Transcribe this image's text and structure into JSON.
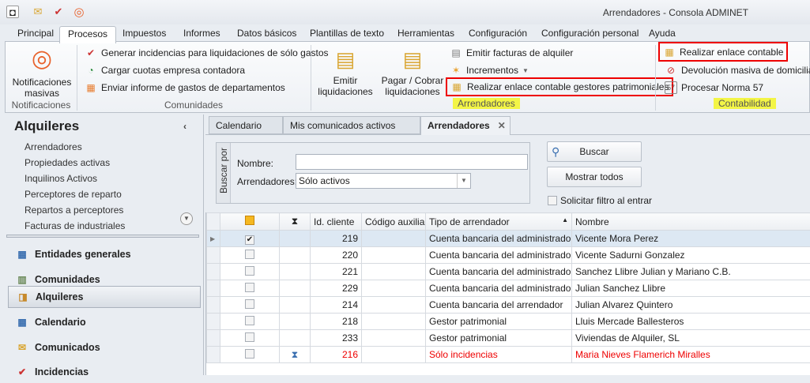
{
  "window": {
    "title": "Arrendadores - Consola ADMINET"
  },
  "ribbon_tabs": [
    "Principal",
    "Procesos",
    "Impuestos",
    "Informes",
    "Datos básicos",
    "Plantillas de texto",
    "Herramientas",
    "Configuración",
    "Configuración personal",
    "Ayuda"
  ],
  "ribbon": {
    "notificaciones": {
      "button": "Notificaciones masivas",
      "label": "Notificaciones"
    },
    "comunidades": {
      "items": [
        "Generar incidencias para liquidaciones de sólo gastos",
        "Cargar cuotas empresa contadora",
        "Enviar informe de gastos de departamentos"
      ],
      "label": "Comunidades"
    },
    "arrendadores": {
      "emitir": "Emitir liquidaciones",
      "pagar": "Pagar / Cobrar liquidaciones",
      "items": [
        "Emitir facturas de alquiler",
        "Incrementos",
        "Realizar enlace contable gestores patrimoniales"
      ],
      "label": "Arrendadores"
    },
    "contabilidad": {
      "items": [
        "Realizar enlace contable",
        "Devolución masiva de domiciliaciones",
        "Procesar Norma 57"
      ],
      "label": "Contabilidad"
    }
  },
  "left": {
    "title": "Alquileres",
    "links": [
      "Arrendadores",
      "Propiedades activas",
      "Inquilinos Activos",
      "Perceptores de reparto",
      "Repartos a perceptores",
      "Facturas de industriales"
    ],
    "nav": [
      "Entidades generales",
      "Comunidades",
      "Alquileres",
      "Calendario",
      "Comunicados",
      "Incidencias"
    ]
  },
  "doc_tabs": [
    "Calendario",
    "Mis comunicados activos",
    "Arrendadores"
  ],
  "filter": {
    "group_label": "Buscar por",
    "nombre_label": "Nombre:",
    "nombre_value": "",
    "arr_label": "Arrendadores:",
    "arr_value": "Sólo activos",
    "buscar": "Buscar",
    "mostrar": "Mostrar todos",
    "solicitar": "Solicitar filtro al entrar"
  },
  "grid": {
    "headers": [
      "Id. cliente",
      "Código auxiliar",
      "Tipo de arrendador",
      "Nombre"
    ],
    "rows": [
      {
        "id": "219",
        "cod": "",
        "tipo": "Cuenta bancaria del administrador",
        "nombre": "Vicente Mora Perez",
        "checked": true
      },
      {
        "id": "220",
        "cod": "",
        "tipo": "Cuenta bancaria del administrador",
        "nombre": "Vicente Sadurni Gonzalez"
      },
      {
        "id": "221",
        "cod": "",
        "tipo": "Cuenta bancaria del administrador",
        "nombre": "Sanchez Llibre Julian y Mariano C.B."
      },
      {
        "id": "229",
        "cod": "",
        "tipo": "Cuenta bancaria del administrador",
        "nombre": "Julian Sanchez Llibre"
      },
      {
        "id": "214",
        "cod": "",
        "tipo": "Cuenta bancaria del arrendador",
        "nombre": "Julian Alvarez Quintero"
      },
      {
        "id": "218",
        "cod": "",
        "tipo": "Gestor patrimonial",
        "nombre": "Lluis Mercade Ballesteros"
      },
      {
        "id": "233",
        "cod": "",
        "tipo": "Gestor patrimonial",
        "nombre": "Viviendas de Alquiler, SL"
      },
      {
        "id": "216",
        "cod": "",
        "tipo": "Sólo incidencias",
        "nombre": "Maria Nieves Flamerich Miralles",
        "red": true,
        "hourglass": true
      }
    ]
  }
}
